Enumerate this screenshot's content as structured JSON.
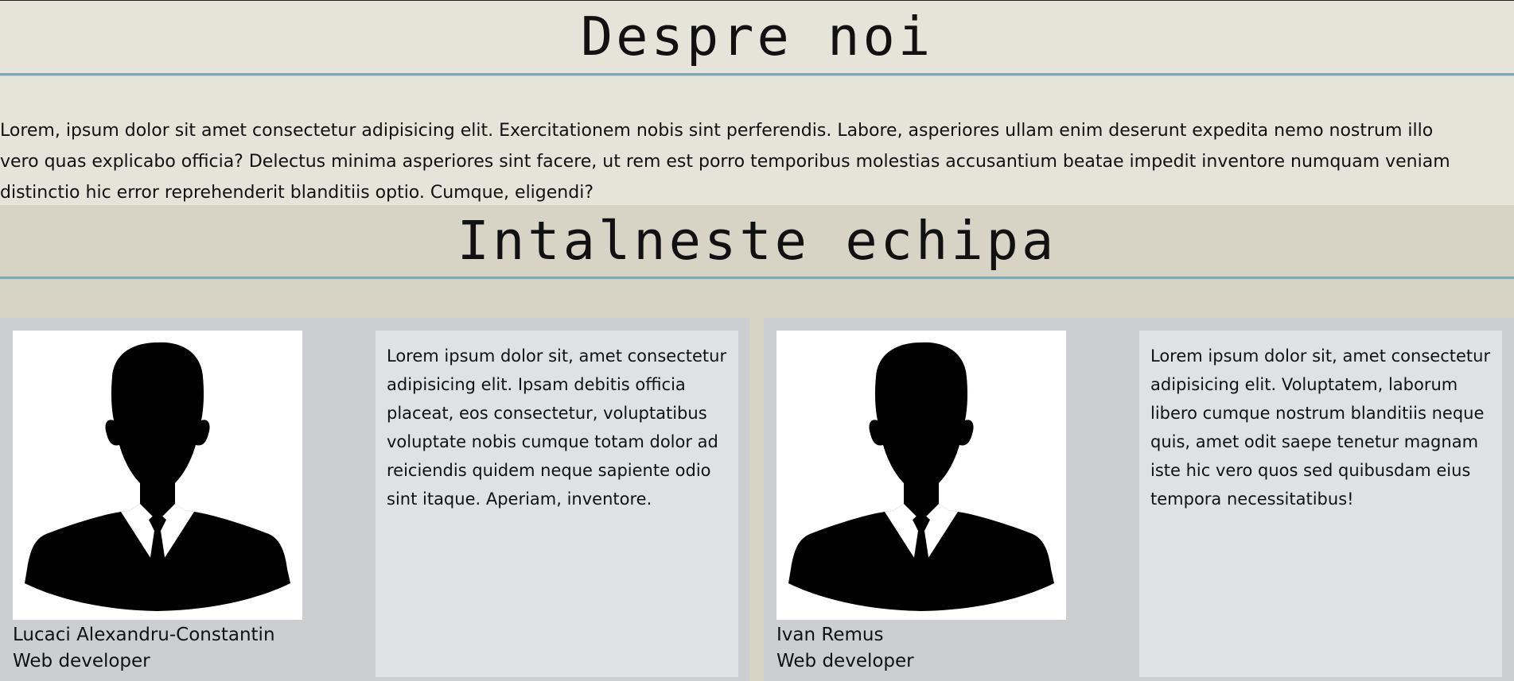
{
  "about": {
    "title": "Despre noi",
    "text": "Lorem, ipsum dolor sit amet consectetur adipisicing elit. Exercitationem nobis sint perferendis. Labore, asperiores ullam enim deserunt expedita nemo nostrum illo vero quas explicabo officia? Delectus minima asperiores sint facere, ut rem est porro temporibus molestias accusantium beatae impedit inventore numquam veniam distinctio hic error reprehenderit blanditiis optio. Cumque, eligendi?"
  },
  "team": {
    "title": "Intalneste echipa",
    "members": [
      {
        "name": "Lucaci Alexandru-Constantin",
        "role": "Web developer",
        "bio": "Lorem ipsum dolor sit, amet consectetur adipisicing elit. Ipsam debitis officia placeat, eos consectetur, voluptatibus voluptate nobis cumque totam dolor ad reiciendis quidem neque sapiente odio sint itaque. Aperiam, inventore.",
        "avatar_icon": "person-silhouette-icon"
      },
      {
        "name": "Ivan Remus",
        "role": "Web developer",
        "bio": "Lorem ipsum dolor sit, amet consectetur adipisicing elit. Voluptatem, laborum libero cumque nostrum blanditiis neque quis, amet odit saepe tenetur magnam iste hic vero quos sed quibusdam eius tempora necessitatibus!",
        "avatar_icon": "person-silhouette-icon"
      }
    ]
  },
  "colors": {
    "about_bg": "#e4e4d8",
    "team_bg": "#d7d4c6",
    "accent_rule": "#7aaab9",
    "card_bg": "#ccced2",
    "bio_bg": "#e0e1e4"
  }
}
